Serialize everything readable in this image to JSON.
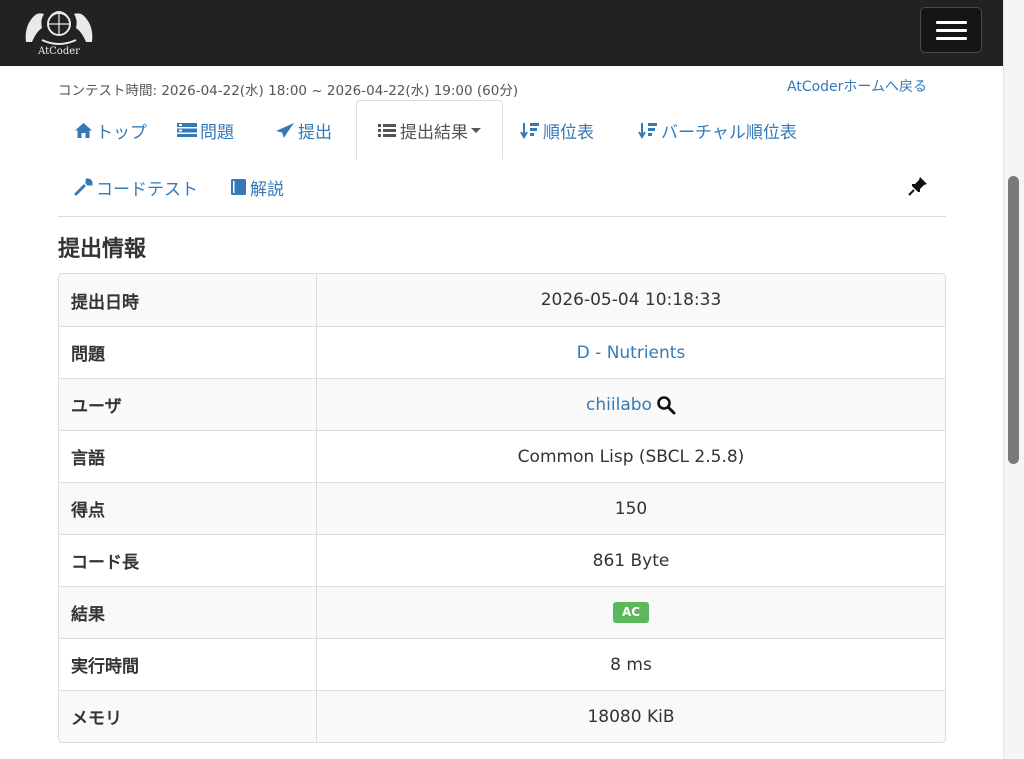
{
  "brand": {
    "name": "AtCoder"
  },
  "header": {
    "contest_time": "コンテスト時間: 2026-04-22(水) 18:00 ~ 2026-04-22(水) 19:00 (60分)",
    "home_link": "AtCoderホームへ戻る"
  },
  "nav": {
    "tabs": [
      {
        "label": "トップ",
        "icon": "home-icon"
      },
      {
        "label": "問題",
        "icon": "tasks-icon"
      },
      {
        "label": "提出",
        "icon": "send-icon"
      },
      {
        "label": "提出結果",
        "icon": "list-icon"
      },
      {
        "label": "順位表",
        "icon": "sort-icon"
      },
      {
        "label": "バーチャル順位表",
        "icon": "sort-icon"
      },
      {
        "label": "コードテスト",
        "icon": "wrench-icon"
      },
      {
        "label": "解説",
        "icon": "book-icon"
      }
    ]
  },
  "section": {
    "title": "提出情報"
  },
  "submission": {
    "rows": [
      {
        "label": "提出日時",
        "value": "2026-05-04 10:18:33"
      },
      {
        "label": "問題",
        "value": "D - Nutrients"
      },
      {
        "label": "ユーザ",
        "value": "chiilabo"
      },
      {
        "label": "言語",
        "value": "Common Lisp (SBCL 2.5.8)"
      },
      {
        "label": "得点",
        "value": "150"
      },
      {
        "label": "コード長",
        "value": "861 Byte"
      },
      {
        "label": "結果",
        "value": "AC"
      },
      {
        "label": "実行時間",
        "value": "8 ms"
      },
      {
        "label": "メモリ",
        "value": "18080 KiB"
      }
    ]
  },
  "colors": {
    "navbar": "#222222",
    "link": "#337ab7",
    "ac_badge": "#5cb85c"
  }
}
